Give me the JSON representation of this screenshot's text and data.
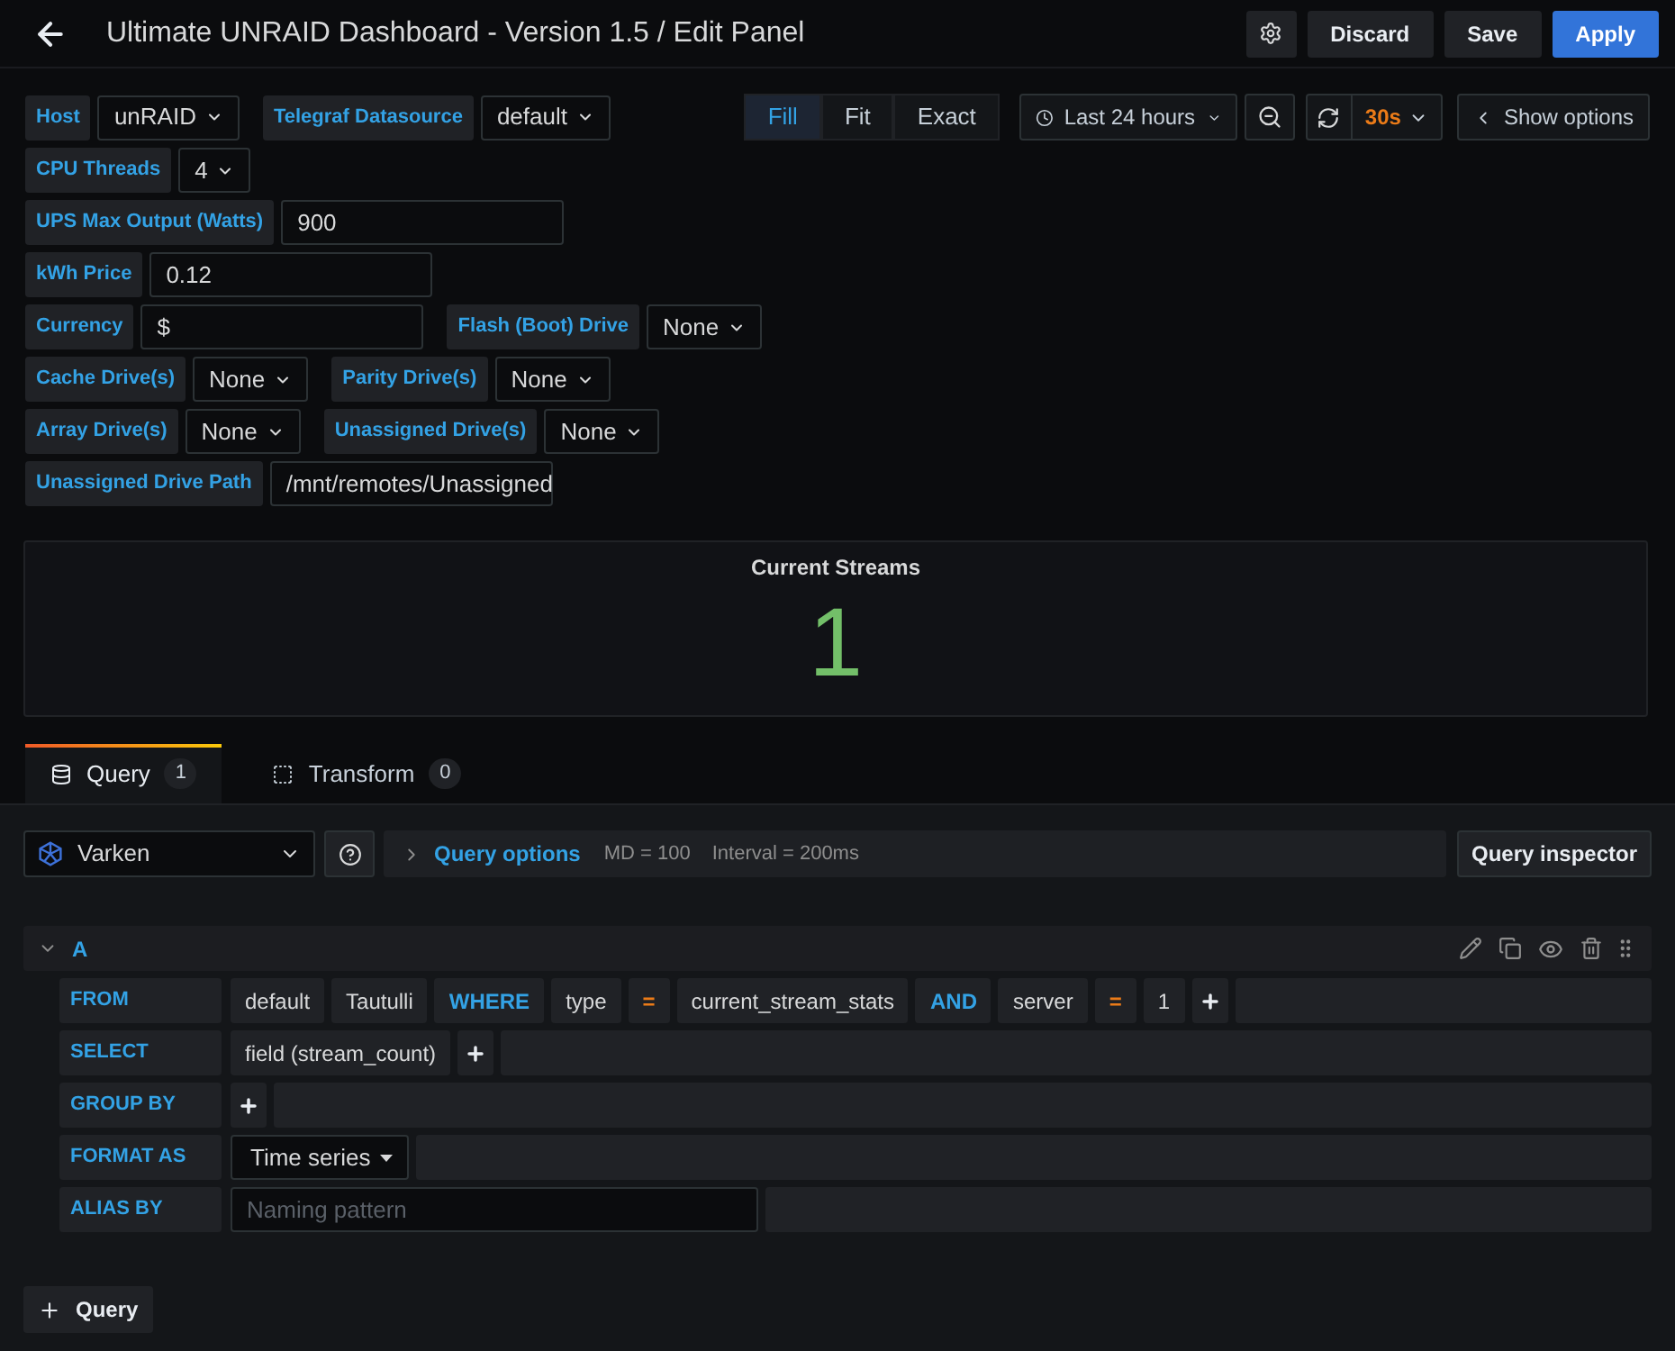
{
  "header": {
    "title": "Ultimate UNRAID Dashboard - Version 1.5 / Edit Panel",
    "buttons": [
      {
        "label": "Discard",
        "kind": "secondary"
      },
      {
        "label": "Save",
        "kind": "secondary"
      },
      {
        "label": "Apply",
        "kind": "primary"
      }
    ]
  },
  "variable_rows": [
    [
      {
        "label": "Host",
        "kind": "select",
        "value": "unRAID"
      },
      {
        "label": "Telegraf Datasource",
        "kind": "select",
        "value": "default"
      }
    ],
    [
      {
        "label": "CPU Threads",
        "kind": "select",
        "value": "4"
      }
    ],
    [
      {
        "label": "UPS Max Output (Watts)",
        "kind": "textbox",
        "value": "900"
      }
    ],
    [
      {
        "label": "kWh Price",
        "kind": "textbox",
        "value": "0.12"
      }
    ],
    [
      {
        "label": "Currency",
        "kind": "textbox",
        "value": "$"
      },
      {
        "label": "Flash (Boot) Drive",
        "kind": "select",
        "value": "None"
      }
    ],
    [
      {
        "label": "Cache Drive(s)",
        "kind": "select",
        "value": "None"
      },
      {
        "label": "Parity Drive(s)",
        "kind": "select",
        "value": "None"
      }
    ],
    [
      {
        "label": "Array Drive(s)",
        "kind": "select",
        "value": "None"
      },
      {
        "label": "Unassigned Drive(s)",
        "kind": "select",
        "value": "None"
      }
    ],
    [
      {
        "label": "Unassigned Drive Path",
        "kind": "textbox",
        "value": "/mnt/remotes/Unassigned"
      }
    ]
  ],
  "toolbar": {
    "fit_modes": [
      {
        "label": "Fill",
        "selected": true
      },
      {
        "label": "Fit",
        "selected": false
      },
      {
        "label": "Exact",
        "selected": false
      }
    ],
    "time_range": "Last 24 hours",
    "refresh_interval": "30s",
    "show_options": "Show options"
  },
  "panel": {
    "title": "Current Streams",
    "value": "1"
  },
  "tabs": [
    {
      "label": "Query",
      "count": "1",
      "kind": "query",
      "selected": true
    },
    {
      "label": "Transform",
      "count": "0",
      "kind": "transform",
      "selected": false
    }
  ],
  "query_bar": {
    "datasource": "Varken",
    "options_label": "Query options",
    "max_data_points": "MD = 100",
    "interval": "Interval = 200ms",
    "inspector": "Query inspector"
  },
  "query": {
    "ref_id": "A",
    "expanded": true,
    "rows": [
      {
        "label": "FROM",
        "segments": [
          {
            "kind": "value",
            "text": "default"
          },
          {
            "kind": "value",
            "text": "Tautulli"
          },
          {
            "kind": "keyword",
            "text": "WHERE"
          },
          {
            "kind": "value",
            "text": "type"
          },
          {
            "kind": "operator",
            "text": "="
          },
          {
            "kind": "value",
            "text": "current_stream_stats"
          },
          {
            "kind": "keyword",
            "text": "AND"
          },
          {
            "kind": "value",
            "text": "server"
          },
          {
            "kind": "operator",
            "text": "="
          },
          {
            "kind": "value",
            "text": "1"
          },
          {
            "kind": "add"
          }
        ]
      },
      {
        "label": "SELECT",
        "segments": [
          {
            "kind": "value",
            "text": "field (stream_count)"
          },
          {
            "kind": "add"
          }
        ]
      },
      {
        "label": "GROUP BY",
        "segments": [
          {
            "kind": "add"
          }
        ]
      },
      {
        "label": "FORMAT AS",
        "segments": [
          {
            "kind": "select",
            "text": "Time series"
          }
        ]
      },
      {
        "label": "ALIAS BY",
        "segments": [
          {
            "kind": "input",
            "placeholder": "Naming pattern"
          }
        ]
      }
    ]
  },
  "add_query": {
    "label": "Query"
  }
}
